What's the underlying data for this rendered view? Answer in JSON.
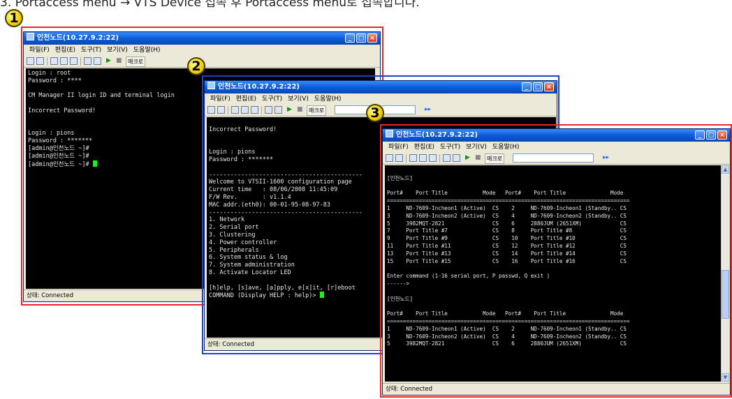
{
  "caption": "3. Portaccess menu → VTS Device 접속 후 Portaccess menu로 접속합니다.",
  "badges": [
    "1",
    "2",
    "3"
  ],
  "colors": {
    "highlight": "#e8262d",
    "titlebar": "#0a5ddb",
    "cursor": "#10ff10",
    "terminal_bg": "#000000"
  },
  "icons": [
    "app-icon",
    "minimize-icon",
    "maximize-icon",
    "close-icon",
    "save-icon",
    "open-icon",
    "copy-icon",
    "paste-icon",
    "play-icon",
    "stop-icon"
  ],
  "windows": [
    {
      "title": "인천노드(10.27.9.2:22)",
      "menu": [
        "파일(F)",
        "편집(E)",
        "도구(T)",
        "보기(V)",
        "도움말(H)"
      ],
      "macro_label": "매크로",
      "status": "상태: Connected",
      "lines": [
        "Login : root",
        "Password : ****",
        "",
        "CM Manager II login ID and terminal login",
        "",
        "Incorrect Password!",
        "",
        "",
        "Login : pions",
        "Password : *******",
        "[admin@인천노드 ~]#",
        "[admin@인천노드 ~]#",
        "[admin@인천노드 ~]#"
      ]
    },
    {
      "title": "인천노드(10.27.9.2:22)",
      "menu": [
        "파일(F)",
        "편집(E)",
        "도구(T)",
        "보기(V)",
        "도움말(H)"
      ],
      "macro_label": "매크로",
      "status": "상태: Connected",
      "lines": [
        "",
        "Incorrect Password!",
        "",
        "",
        "Login : pions",
        "Password : *******",
        "",
        "-------------------------------------------",
        "Welcome to VTSII-1600 configuration page",
        "Current time   : 08/06/2008 11:45:09",
        "F/W Rev.       : v1.1.4",
        "MAC addr.(eth0): 00-01-95-08-97-83",
        "-------------------------------------------",
        "1. Network",
        "2. Serial port",
        "3. Clustering",
        "4. Power controller",
        "5. Peripherals",
        "6. System status & log",
        "7. System administration",
        "8. Activate Locator LED",
        "",
        "[h]elp, [s]ave, [a]pply, e[x]it, [r]eboot",
        "COMMAND (Display HELP : help)>"
      ]
    },
    {
      "title": "인천노드(10.27.9.2:22)",
      "menu": [
        "파일(F)",
        "편집(E)",
        "도구(T)",
        "보기(V)",
        "도움말(H)"
      ],
      "macro_label": "매크로",
      "status": "상태: Connected",
      "lines": [
        "",
        "[인천노드]",
        "",
        "Port#    Port Title           Mode   Port#    Port Title              Mode",
        "============================================================================",
        "1     ND-7609-Incheon1 (Active)  CS    2     ND-7609-Incheon1 (Standby.. CS",
        "3     ND-7609-Incheon2 (Active)  CS    4     ND-7609-Incheon2 (Standby.. CS",
        "5     3982MQT-2821               CS    6     2880JUM (2651XM)            CS",
        "7     Port Title #7              CS    8     Port Title #8               CS",
        "9     Port Title #9              CS    10    Port Title #10              CS",
        "11    Port Title #11             CS    12    Port Title #12              CS",
        "13    Port Title #13             CS    14    Port Title #14              CS",
        "15    Port Title #15             CS    16    Port Title #16              CS",
        "",
        "Enter command (1-16 serial port, P passwd, Q exit )",
        "------>",
        "",
        "[인천노드]",
        "",
        "Port#    Port Title           Mode   Port#    Port Title              Mode",
        "============================================================================",
        "1     ND-7609-Incheon1 (Active)  CS    2     ND-7609-Incheon1 (Standby.. CS",
        "3     ND-7609-Incheon2 (Active)  CS    4     ND-7609-Incheon2 (Standby.. CS",
        "5     3982MQT-2821               CS    6     2880JUM (2651XM)            CS"
      ]
    }
  ]
}
